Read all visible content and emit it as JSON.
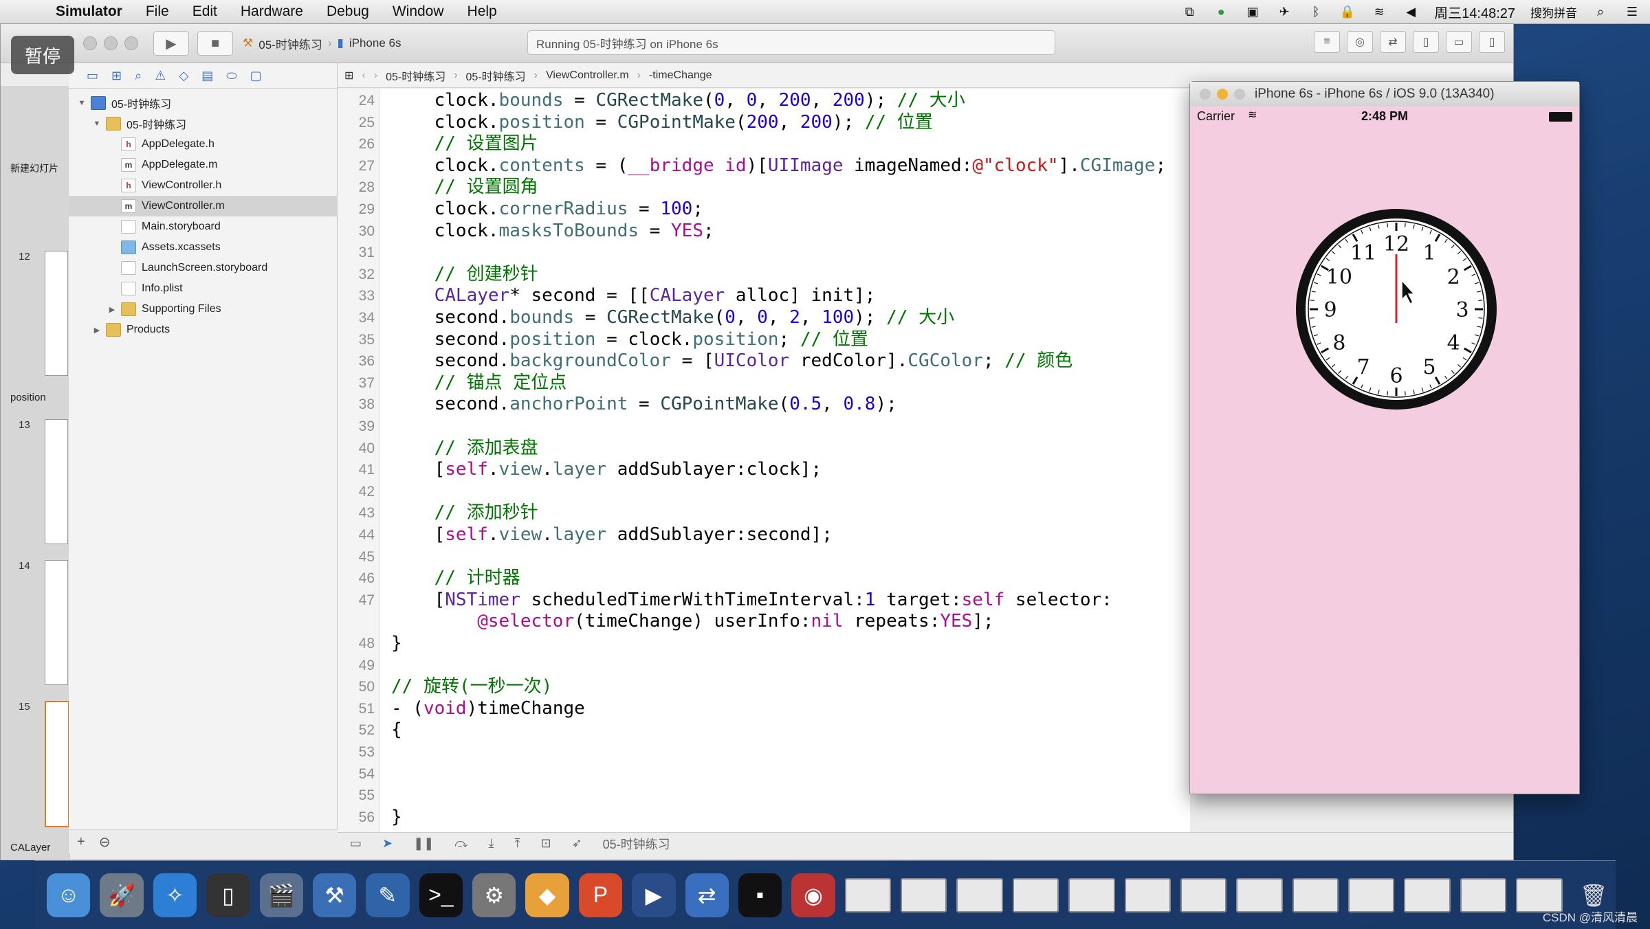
{
  "menubar": {
    "app": "Simulator",
    "items": [
      "File",
      "Edit",
      "Hardware",
      "Debug",
      "Window",
      "Help"
    ],
    "clock": "周三14:48:27",
    "input_method": "搜狗拼音"
  },
  "overlay": {
    "pause_label": "暂停"
  },
  "toolbar": {
    "scheme_target": "05-时钟练习",
    "scheme_device": "iPhone 6s",
    "activity": "Running 05-时钟练习 on iPhone 6s"
  },
  "slides": {
    "new_slide_label": "新建幻灯片",
    "section1": "position",
    "section2": "CALayer",
    "numbers": [
      "12",
      "13",
      "14",
      "15"
    ]
  },
  "navigator": {
    "items": [
      {
        "label": "05-时钟练习",
        "type": "proj",
        "depth": 0,
        "disclosure": "open"
      },
      {
        "label": "05-时钟练习",
        "type": "folder",
        "depth": 1,
        "disclosure": "open"
      },
      {
        "label": "AppDelegate.h",
        "type": "h",
        "depth": 2
      },
      {
        "label": "AppDelegate.m",
        "type": "m",
        "depth": 2
      },
      {
        "label": "ViewController.h",
        "type": "h",
        "depth": 2
      },
      {
        "label": "ViewController.m",
        "type": "m",
        "depth": 2,
        "selected": true
      },
      {
        "label": "Main.storyboard",
        "type": "file",
        "depth": 2
      },
      {
        "label": "Assets.xcassets",
        "type": "asset",
        "depth": 2
      },
      {
        "label": "LaunchScreen.storyboard",
        "type": "file",
        "depth": 2
      },
      {
        "label": "Info.plist",
        "type": "file",
        "depth": 2
      },
      {
        "label": "Supporting Files",
        "type": "folder",
        "depth": 2,
        "disclosure": "closed"
      },
      {
        "label": "Products",
        "type": "folder",
        "depth": 1,
        "disclosure": "closed"
      }
    ]
  },
  "jumpbar": {
    "crumbs": [
      "05-时钟练习",
      "05-时钟练习",
      "ViewController.m",
      "-timeChange"
    ]
  },
  "editor": {
    "lines": [
      {
        "n": "24",
        "html": "    clock.<span class='prop'>bounds</span> = <span class='fn'>CGRectMake</span>(<span class='num'>0</span>, <span class='num'>0</span>, <span class='num'>200</span>, <span class='num'>200</span>); <span class='cm'>// 大小</span>"
      },
      {
        "n": "25",
        "html": "    clock.<span class='prop'>position</span> = <span class='fn'>CGPointMake</span>(<span class='num'>200</span>, <span class='num'>200</span>); <span class='cm'>// 位置</span>"
      },
      {
        "n": "26",
        "html": "    <span class='cm'>// 设置图片</span>"
      },
      {
        "n": "27",
        "html": "    clock.<span class='prop'>contents</span> = (<span class='kw'>__bridge</span> <span class='kw'>id</span>)[<span class='cls'>UIImage</span> imageNamed:<span class='str'>@\"clock\"</span>].<span class='prop'>CGImage</span>;"
      },
      {
        "n": "28",
        "html": "    <span class='cm'>// 设置圆角</span>"
      },
      {
        "n": "29",
        "html": "    clock.<span class='prop'>cornerRadius</span> = <span class='num'>100</span>;"
      },
      {
        "n": "30",
        "html": "    clock.<span class='prop'>masksToBounds</span> = <span class='kw'>YES</span>;"
      },
      {
        "n": "31",
        "html": ""
      },
      {
        "n": "32",
        "html": "    <span class='cm'>// 创建秒针</span>"
      },
      {
        "n": "33",
        "html": "    <span class='cls'>CALayer</span>* second = [[<span class='cls'>CALayer</span> alloc] init];"
      },
      {
        "n": "34",
        "html": "    second.<span class='prop'>bounds</span> = <span class='fn'>CGRectMake</span>(<span class='num'>0</span>, <span class='num'>0</span>, <span class='num'>2</span>, <span class='num'>100</span>); <span class='cm'>// 大小</span>"
      },
      {
        "n": "35",
        "html": "    second.<span class='prop'>position</span> = clock.<span class='prop'>position</span>; <span class='cm'>// 位置</span>"
      },
      {
        "n": "36",
        "html": "    second.<span class='prop'>backgroundColor</span> = [<span class='cls'>UIColor</span> redColor].<span class='prop'>CGColor</span>; <span class='cm'>// 颜色</span>"
      },
      {
        "n": "37",
        "html": "    <span class='cm'>// 锚点 定位点</span>"
      },
      {
        "n": "38",
        "html": "    second.<span class='prop'>anchorPoint</span> = <span class='fn'>CGPointMake</span>(<span class='num'>0.5</span>, <span class='num'>0.8</span>);"
      },
      {
        "n": "39",
        "html": ""
      },
      {
        "n": "40",
        "html": "    <span class='cm'>// 添加表盘</span>"
      },
      {
        "n": "41",
        "html": "    [<span class='kw'>self</span>.<span class='prop'>view</span>.<span class='prop'>layer</span> addSublayer:clock];"
      },
      {
        "n": "42",
        "html": ""
      },
      {
        "n": "43",
        "html": "    <span class='cm'>// 添加秒针</span>"
      },
      {
        "n": "44",
        "html": "    [<span class='kw'>self</span>.<span class='prop'>view</span>.<span class='prop'>layer</span> addSublayer:second];"
      },
      {
        "n": "45",
        "html": ""
      },
      {
        "n": "46",
        "html": "    <span class='cm'>// 计时器</span>"
      },
      {
        "n": "47",
        "html": "    [<span class='cls'>NSTimer</span> scheduledTimerWithTimeInterval:<span class='num'>1</span> target:<span class='kw'>self</span> selector:"
      },
      {
        "n": "",
        "html": "        <span class='kw'>@selector</span>(timeChange) userInfo:<span class='kw'>nil</span> repeats:<span class='kw'>YES</span>];"
      },
      {
        "n": "48",
        "html": "}"
      },
      {
        "n": "49",
        "html": ""
      },
      {
        "n": "50",
        "html": "<span class='cm'>// 旋转(一秒一次)</span>"
      },
      {
        "n": "51",
        "html": "- (<span class='kw'>void</span>)timeChange"
      },
      {
        "n": "52",
        "html": "{"
      },
      {
        "n": "53",
        "html": ""
      },
      {
        "n": "54",
        "html": ""
      },
      {
        "n": "55",
        "html": ""
      },
      {
        "n": "56",
        "html": "}"
      }
    ]
  },
  "editor_bottom": {
    "target": "05-时钟练习"
  },
  "simulator": {
    "title": "iPhone 6s - iPhone 6s / iOS 9.0 (13A340)",
    "carrier": "Carrier",
    "time": "2:48 PM",
    "clock_numbers": [
      "12",
      "1",
      "2",
      "3",
      "4",
      "5",
      "6",
      "7",
      "8",
      "9",
      "10",
      "11"
    ]
  },
  "watermark": "CSDN @清风清晨"
}
